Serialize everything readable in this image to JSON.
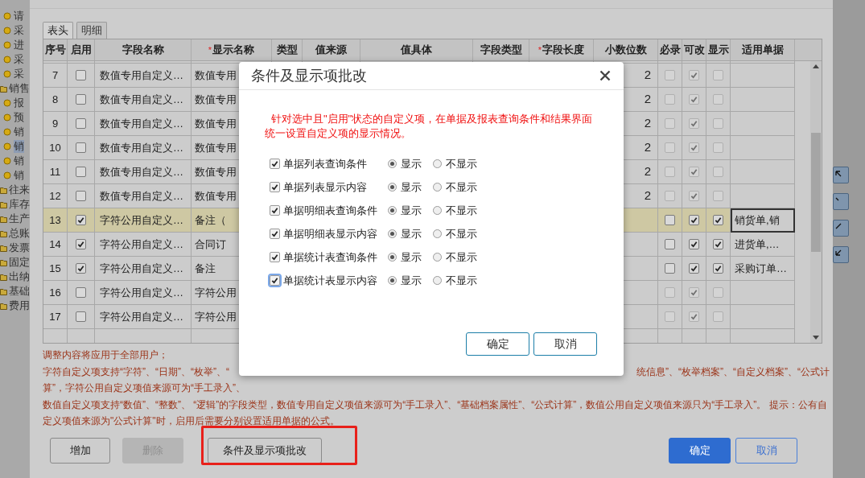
{
  "sidebar": {
    "items": [
      {
        "kind": "leaf",
        "label": "请",
        "selected": false
      },
      {
        "kind": "leaf",
        "label": "采",
        "selected": false
      },
      {
        "kind": "leaf",
        "label": "进",
        "selected": false
      },
      {
        "kind": "leaf",
        "label": "采",
        "selected": false
      },
      {
        "kind": "leaf",
        "label": "采",
        "selected": false
      },
      {
        "kind": "folder",
        "label": "销售",
        "selected": false,
        "children": [
          {
            "kind": "leaf",
            "label": "报",
            "selected": false
          },
          {
            "kind": "leaf",
            "label": "预",
            "selected": false
          },
          {
            "kind": "leaf",
            "label": "销",
            "selected": false
          },
          {
            "kind": "leaf",
            "label": "销",
            "selected": true
          },
          {
            "kind": "leaf",
            "label": "销",
            "selected": false
          },
          {
            "kind": "leaf",
            "label": "销",
            "selected": false
          }
        ]
      },
      {
        "kind": "folder",
        "label": "往来",
        "selected": false
      },
      {
        "kind": "folder",
        "label": "库存",
        "selected": false
      },
      {
        "kind": "folder",
        "label": "生产",
        "selected": false
      },
      {
        "kind": "folder",
        "label": "总账",
        "selected": false
      },
      {
        "kind": "folder",
        "label": "发票",
        "selected": false
      },
      {
        "kind": "folder",
        "label": "固定",
        "selected": false
      },
      {
        "kind": "folder",
        "label": "出纳",
        "selected": false
      },
      {
        "kind": "folder",
        "label": "基础",
        "selected": false
      },
      {
        "kind": "folder",
        "label": "费用",
        "selected": false
      }
    ]
  },
  "tabs": [
    {
      "label": "表头",
      "selected": true
    },
    {
      "label": "明细",
      "selected": false
    }
  ],
  "table": {
    "columns": [
      {
        "label": "序号"
      },
      {
        "label": "启用"
      },
      {
        "label": "字段名称"
      },
      {
        "label": "显示名称",
        "mark": "*"
      },
      {
        "label": "类型"
      },
      {
        "label": "值来源"
      },
      {
        "label": "值具体"
      },
      {
        "label": "字段类型"
      },
      {
        "label": "字段长度",
        "mark": "*"
      },
      {
        "label": "小数位数"
      },
      {
        "label": "必录"
      },
      {
        "label": "可改"
      },
      {
        "label": "显示"
      },
      {
        "label": "适用单据"
      }
    ],
    "rows": [
      {
        "no": "7",
        "enabled": false,
        "field_name": "数值专用自定义…",
        "display_name": "数值专用",
        "decimals": "2",
        "mandatory": false,
        "editable": true,
        "shown": false,
        "selected": false,
        "editing": false
      },
      {
        "no": "8",
        "enabled": false,
        "field_name": "数值专用自定义…",
        "display_name": "数值专用",
        "decimals": "2",
        "mandatory": false,
        "editable": true,
        "shown": false,
        "selected": false,
        "editing": false
      },
      {
        "no": "9",
        "enabled": false,
        "field_name": "数值专用自定义…",
        "display_name": "数值专用",
        "decimals": "2",
        "mandatory": false,
        "editable": true,
        "shown": false,
        "selected": false,
        "editing": false
      },
      {
        "no": "10",
        "enabled": false,
        "field_name": "数值专用自定义…",
        "display_name": "数值专用",
        "decimals": "2",
        "mandatory": false,
        "editable": true,
        "shown": false,
        "selected": false,
        "editing": false
      },
      {
        "no": "11",
        "enabled": false,
        "field_name": "数值专用自定义…",
        "display_name": "数值专用",
        "decimals": "2",
        "mandatory": false,
        "editable": true,
        "shown": false,
        "selected": false,
        "editing": false
      },
      {
        "no": "12",
        "enabled": false,
        "field_name": "数值专用自定义…",
        "display_name": "数值专用",
        "decimals": "2",
        "mandatory": false,
        "editable": true,
        "shown": false,
        "selected": false,
        "editing": false
      },
      {
        "no": "13",
        "enabled": true,
        "field_name": "字符公用自定义…",
        "display_name": "备注（",
        "mandatory": false,
        "editable": true,
        "shown": true,
        "documents": "销货单,销",
        "selected": true,
        "editing": true
      },
      {
        "no": "14",
        "enabled": true,
        "field_name": "字符公用自定义…",
        "display_name": "合同订",
        "mandatory": false,
        "editable": true,
        "shown": true,
        "documents": "进货单,…",
        "selected": false,
        "editing": false
      },
      {
        "no": "15",
        "enabled": true,
        "field_name": "字符公用自定义…",
        "display_name": "备注",
        "mandatory": false,
        "editable": true,
        "shown": true,
        "documents": "采购订单…",
        "selected": false,
        "editing": false
      },
      {
        "no": "16",
        "enabled": false,
        "field_name": "字符公用自定义…",
        "display_name": "字符公用",
        "mandatory": false,
        "editable": true,
        "shown": false,
        "selected": false,
        "editing": false
      },
      {
        "no": "17",
        "enabled": false,
        "field_name": "字符公用自定义…",
        "display_name": "字符公用",
        "mandatory": false,
        "editable": true,
        "shown": false,
        "selected": false,
        "editing": false
      }
    ]
  },
  "notes": [
    {
      "left": "调整内容将应用于全部用户；"
    },
    {
      "left": "字符自定义项支持“字符”、“日期”、“枚举”、“",
      "right": "统信息”、“枚举档案”、“自定义档案”、“公式计"
    },
    {
      "left": "算”，字符公用自定义项值来源可为“手工录入”、"
    },
    {
      "left": "数值自定义项支持“数值”、“整数”、 “逻辑”的字段类型，数值专用自定义项值来源可为“手工录入”、“基础档案属性”、“公式计算”，数值公用自定义项值来源只为“手工录入”。 提示：公有自"
    },
    {
      "left": "定义项值来源为\"公式计算\"时，启用后需要分别设置适用单据的公式。"
    }
  ],
  "buttons": [
    {
      "label": "增加",
      "disabled": false,
      "highlighted": false
    },
    {
      "label": "删除",
      "disabled": true,
      "highlighted": false
    },
    {
      "label": "条件及显示项批改",
      "disabled": false,
      "highlighted": true
    }
  ],
  "footer_buttons": [
    {
      "label": "确定",
      "primary": true
    },
    {
      "label": "取消",
      "primary": false
    }
  ],
  "dialog": {
    "title": "条件及显示项批改",
    "message": "针对选中且\"启用\"状态的自定义项，在单据及报表查询条件和结果界面统一设置自定义项的显示情况。",
    "options": [
      {
        "label": "单据列表查询条件",
        "checked": true,
        "focused": false,
        "choices": [
          {
            "label": "显示",
            "selected": true
          },
          {
            "label": "不显示",
            "selected": false
          }
        ]
      },
      {
        "label": "单据列表显示内容",
        "checked": true,
        "focused": false,
        "choices": [
          {
            "label": "显示",
            "selected": true
          },
          {
            "label": "不显示",
            "selected": false
          }
        ]
      },
      {
        "label": "单据明细表查询条件",
        "checked": true,
        "focused": false,
        "choices": [
          {
            "label": "显示",
            "selected": true
          },
          {
            "label": "不显示",
            "selected": false
          }
        ]
      },
      {
        "label": "单据明细表显示内容",
        "checked": true,
        "focused": false,
        "choices": [
          {
            "label": "显示",
            "selected": true
          },
          {
            "label": "不显示",
            "selected": false
          }
        ]
      },
      {
        "label": "单据统计表查询条件",
        "checked": true,
        "focused": false,
        "choices": [
          {
            "label": "显示",
            "selected": true
          },
          {
            "label": "不显示",
            "selected": false
          }
        ]
      },
      {
        "label": "单据统计表显示内容",
        "checked": true,
        "focused": true,
        "choices": [
          {
            "label": "显示",
            "selected": true
          },
          {
            "label": "不显示",
            "selected": false
          }
        ]
      }
    ],
    "buttons": [
      {
        "label": "确定"
      },
      {
        "label": "取消"
      }
    ]
  }
}
